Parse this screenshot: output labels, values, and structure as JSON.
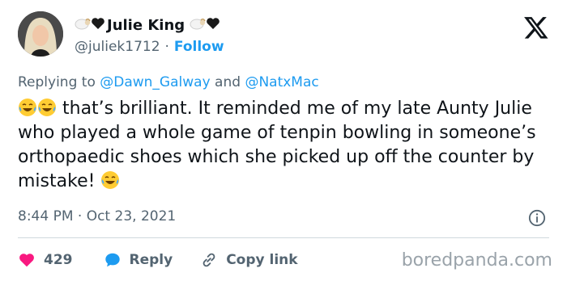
{
  "author": {
    "name": "Julie King",
    "handle": "@juliek1712",
    "separator": "·",
    "follow_label": "Follow"
  },
  "reply_context": {
    "prefix": "Replying to",
    "mention1": "@Dawn_Galway",
    "joiner": "and",
    "mention2": "@NatxMac"
  },
  "tweet": {
    "text_part1": "that’s brilliant. It reminded me of my late Aunty Julie who played a whole game of tenpin bowling in someone’s orthopaedic shoes which she picked up off the counter by mistake!",
    "timestamp": "8:44 PM · Oct 23, 2021"
  },
  "actions": {
    "likes": "429",
    "reply_label": "Reply",
    "copy_label": "Copy link"
  },
  "watermark": "boredpanda.com",
  "icons": {
    "x_logo": "x-logo-icon",
    "info": "info-icon",
    "heart": "heart-icon",
    "reply": "speech-bubble-icon",
    "link": "link-icon",
    "emoji": "face-with-tears-of-joy-icon",
    "ram": "ram-emoji-icon",
    "black_heart": "black-heart-icon"
  },
  "colors": {
    "accent": "#1d9bf0",
    "like": "#f91880",
    "muted": "#536471",
    "text": "#0f1419"
  }
}
